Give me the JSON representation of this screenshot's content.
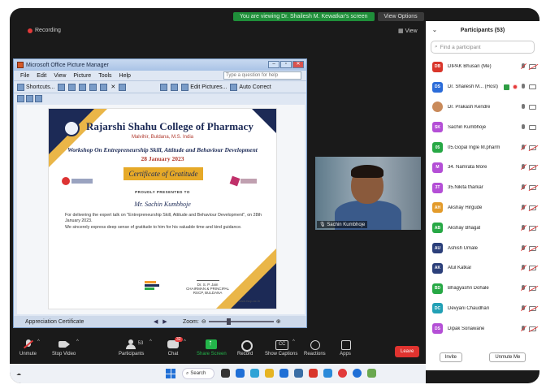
{
  "banner": {
    "viewing": "You are viewing Dr. Shailesh M. Kewatkar's screen",
    "view_options": "View Options"
  },
  "meeting": {
    "recording": "Recording",
    "view": "View"
  },
  "picture_manager": {
    "title": "Microsoft Office Picture Manager",
    "menu": [
      "File",
      "Edit",
      "View",
      "Picture",
      "Tools",
      "Help"
    ],
    "help_placeholder": "Type a question for help",
    "toolbar": {
      "shortcuts": "Shortcuts...",
      "edit_pictures": "Edit Pictures...",
      "auto_correct": "Auto Correct"
    },
    "status_file": "Appreciation Certificate",
    "zoom_label": "Zoom:"
  },
  "certificate": {
    "college": "Rajarshi Shahu College of Pharmacy",
    "address": "Malvihir, Buldana, M.S. India",
    "workshop": "Workshop On Entrepreneurship Skill, Attitude and Behaviour Development",
    "date": "28 January 2023",
    "heading": "Certificate of Gratitude",
    "presented": "PROUDLY PRESENTED TO",
    "recipient": "Mr. Sachin Kumbhoje",
    "body1": "For delivering the expert talk on \"Entrepreneurship Skill, Attitude and Behaviour Development\", on 28th January 2023.",
    "body2": "We sincerely express deep sense of gratitude to him for his valuable time and kind guidance.",
    "signatory": "Dr. S. P. Jain",
    "signatory_title": "CHAIRMAN & PRINCIPAL",
    "signatory_org": "RSCP, BULDANA",
    "website": "www.rscp.ac.in"
  },
  "video": {
    "name": "Sachin Kumbhoje"
  },
  "controls": {
    "mute": "Unmute",
    "video": "Stop Video",
    "participants": "Participants",
    "participants_count": "53",
    "chat": "Chat",
    "chat_badge": "32",
    "share": "Share Screen",
    "record": "Record",
    "captions": "Show Captions",
    "reactions": "Reactions",
    "apps": "Apps",
    "leave": "Leave"
  },
  "panel": {
    "title": "Participants (53)",
    "search_placeholder": "Find a participant",
    "invite": "Invite",
    "unmute_me": "Unmute Me",
    "participants": [
      {
        "initials": "DB",
        "name": "DIPAK Bhusari (Me)",
        "color": "#d9362b"
      },
      {
        "initials": "DS",
        "name": "Dr. Shailesh M... (Host)",
        "color": "#2b6cd9"
      },
      {
        "initials": "",
        "name": "Dr. Prakash Kendre",
        "color": "#c98a5a"
      },
      {
        "initials": "SK",
        "name": "Sachin Kumbhoje",
        "color": "#b44fd6"
      },
      {
        "initials": "05",
        "name": "05.Gopal Ingle M.pharm",
        "color": "#27a845"
      },
      {
        "initials": "M",
        "name": "34. Namrata More",
        "color": "#b44fd6"
      },
      {
        "initials": "3T",
        "name": "35.Nikita tharkar",
        "color": "#b44fd6"
      },
      {
        "initials": "AH",
        "name": "Akshay Hirgude",
        "color": "#e39b2b"
      },
      {
        "initials": "AB",
        "name": "Akshay Bhagat",
        "color": "#27a845"
      },
      {
        "initials": "AU",
        "name": "Ashish Umale",
        "color": "#2b3f7a"
      },
      {
        "initials": "AK",
        "name": "Atul Katkar",
        "color": "#2b3f7a"
      },
      {
        "initials": "BD",
        "name": "Bhagyashri Dohale",
        "color": "#27a845"
      },
      {
        "initials": "DC",
        "name": "Devyani Chaudhari",
        "color": "#22a0b5"
      },
      {
        "initials": "DS",
        "name": "Dipak Sonawane",
        "color": "#b44fd6"
      }
    ]
  },
  "taskbar": {
    "search": "Search"
  }
}
